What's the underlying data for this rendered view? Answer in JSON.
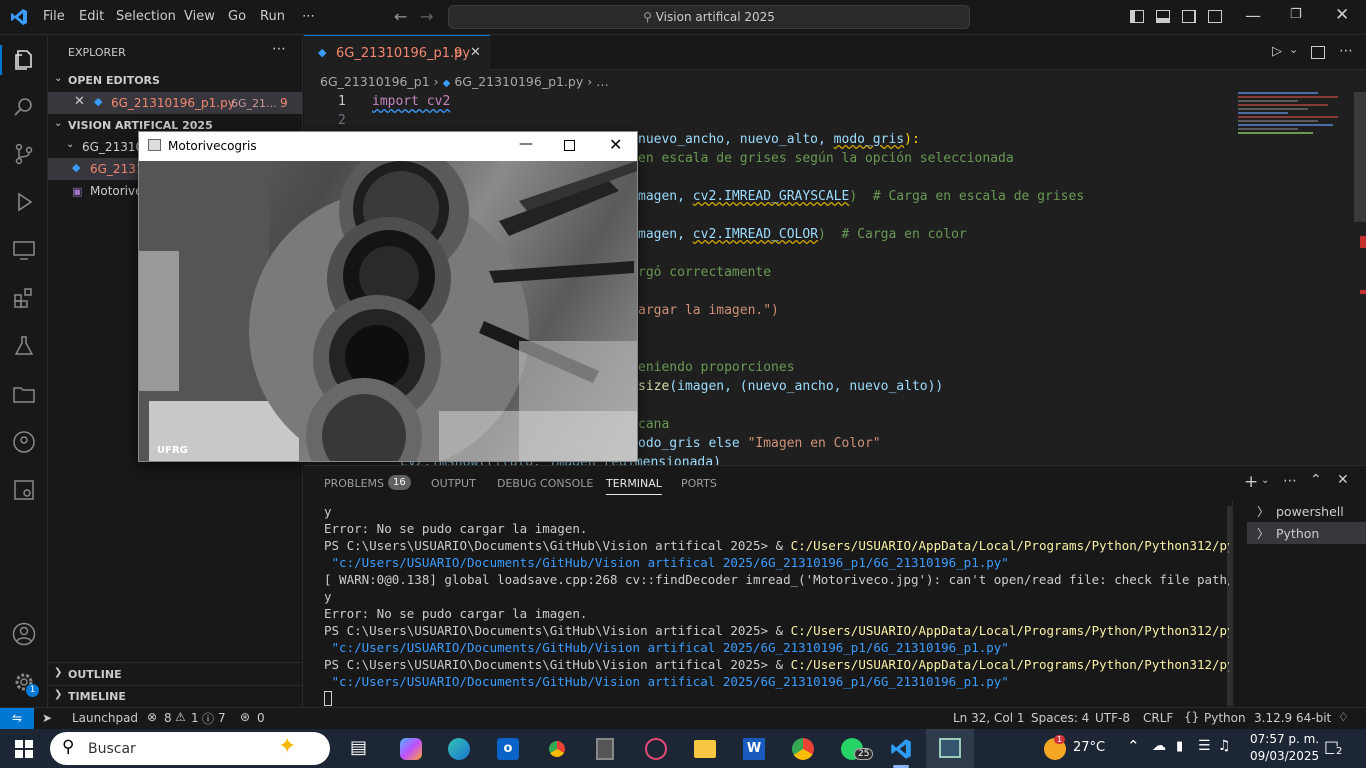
{
  "titlebar": {
    "menu": [
      "File",
      "Edit",
      "Selection",
      "View",
      "Go",
      "Run",
      "⋯"
    ],
    "search": "Vision artifical 2025"
  },
  "sidebar": {
    "title": "EXPLORER",
    "open_editors": "OPEN EDITORS",
    "open_file": "6G_21310196_p1.py",
    "open_file_path": "6G_21...",
    "open_file_badge": "9",
    "folder": "VISION ARTIFICAL 2025",
    "subfolder": "6G_2131019...",
    "file1": "6G_2131...",
    "file2": "Motorive...",
    "outline": "OUTLINE",
    "timeline": "TIMELINE"
  },
  "editor": {
    "tab": "6G_21310196_p1.py",
    "tab_badge": "9",
    "breadcrumb_folder": "6G_21310196_p1",
    "breadcrumb_file": "6G_21310196_p1.py",
    "breadcrumb_more": "…"
  },
  "code": {
    "l1": "import cv2",
    "l3a": "nuevo_ancho, nuevo_alto, ",
    "l3b": "modo_gris",
    "l3c": "):",
    "l4": "en escala de grises según la opción seleccionada",
    "l6a": "magen, ",
    "l6b": "cv2.IMREAD_GRAYSCALE",
    "l6c": ")  # Carga en escala de grises",
    "l8a": "magen, ",
    "l8b": "cv2.IMREAD_COLOR",
    "l8c": ")  # Carga en color",
    "l10": "rgó correctamente",
    "l12": "argar la imagen.\")",
    "l15": "eniendo proporciones",
    "l16a": "size",
    "l16b": "(imagen, (nuevo_ancho, nuevo_alto))",
    "l18": "cana",
    "l19a": "odo_gris else ",
    "l19b": "\"Imagen en Color\"",
    "l20": "cv2.imshow(titulo, imagen_redimensionada)"
  },
  "window": {
    "title": "Motorivecogris",
    "watermark": "UFRG"
  },
  "panel": {
    "tabs": [
      "PROBLEMS",
      "OUTPUT",
      "DEBUG CONSOLE",
      "TERMINAL",
      "PORTS"
    ],
    "problems_count": "16",
    "shells": [
      "powershell",
      "Python"
    ],
    "lines": [
      {
        "t": "y",
        "c": "#cccccc"
      },
      {
        "t": "Error: No se pudo cargar la imagen.",
        "c": "#cccccc"
      },
      {
        "t": "PS C:\\Users\\USUARIO\\Documents\\GitHub\\Vision artifical 2025> & ",
        "c": "#cccccc",
        "y": "C:/Users/USUARIO/AppData/Local/Programs/Python/Python312/python.exe"
      },
      {
        "t": " \"c:/Users/USUARIO/Documents/GitHub/Vision artifical 2025/6G_21310196_p1/6G_21310196_p1.py\"",
        "c": "#3b9cff"
      },
      {
        "t": "[ WARN:0@0.138] global loadsave.cpp:268 cv::findDecoder imread_('Motoriveco.jpg'): can't open/read file: check file path/integrit",
        "c": "#cccccc"
      },
      {
        "t": "y",
        "c": "#cccccc"
      },
      {
        "t": "Error: No se pudo cargar la imagen.",
        "c": "#cccccc"
      },
      {
        "t": "PS C:\\Users\\USUARIO\\Documents\\GitHub\\Vision artifical 2025> & ",
        "c": "#cccccc",
        "y": "C:/Users/USUARIO/AppData/Local/Programs/Python/Python312/python.exe"
      },
      {
        "t": " \"c:/Users/USUARIO/Documents/GitHub/Vision artifical 2025/6G_21310196_p1/6G_21310196_p1.py\"",
        "c": "#3b9cff"
      },
      {
        "t": "PS C:\\Users\\USUARIO\\Documents\\GitHub\\Vision artifical 2025> & ",
        "c": "#cccccc",
        "y": "C:/Users/USUARIO/AppData/Local/Programs/Python/Python312/python.exe"
      },
      {
        "t": " \"c:/Users/USUARIO/Documents/GitHub/Vision artifical 2025/6G_21310196_p1/6G_21310196_p1.py\"",
        "c": "#3b9cff"
      }
    ]
  },
  "status": {
    "launchpad": "Launchpad",
    "errors": "8",
    "warnings": "1",
    "info": "7",
    "ports": "0",
    "position": "Ln 32, Col 1",
    "spaces": "Spaces: 4",
    "encoding": "UTF-8",
    "eol": "CRLF",
    "lang": "Python",
    "version": "3.12.9 64-bit"
  },
  "taskbar": {
    "search": "Buscar",
    "temp": "27°C",
    "time": "07:57 p. m.",
    "date": "09/03/2025",
    "notif": "2",
    "whatsapp_badge": "25",
    "weather_badge": "1"
  }
}
